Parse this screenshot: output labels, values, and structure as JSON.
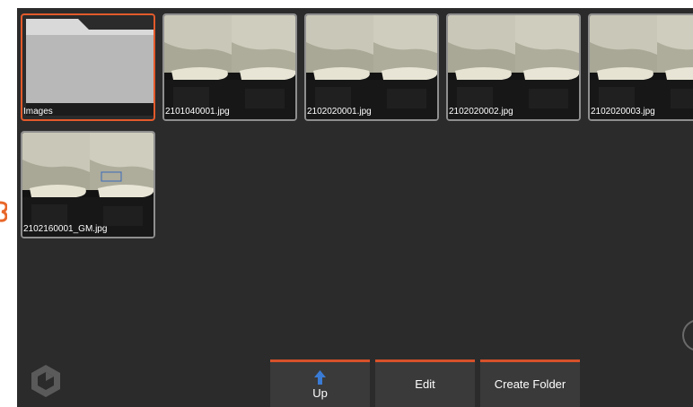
{
  "gallery": {
    "folders": [
      {
        "label": "Images"
      }
    ],
    "files": [
      {
        "label": "2101040001.jpg"
      },
      {
        "label": "2102020001.jpg"
      },
      {
        "label": "2102020002.jpg"
      },
      {
        "label": "2102020003.jpg"
      },
      {
        "label": "2102160001_GM.jpg"
      }
    ]
  },
  "toolbar": {
    "up_label": "Up",
    "edit_label": "Edit",
    "create_folder_label": "Create Folder"
  },
  "colors": {
    "accent": "#e35a2b",
    "background": "#2b2b2b",
    "up_arrow": "#3a7bd5"
  },
  "icons": {
    "up": "arrow-up-icon",
    "logo": "brand-logo-icon",
    "folder": "folder-icon"
  }
}
